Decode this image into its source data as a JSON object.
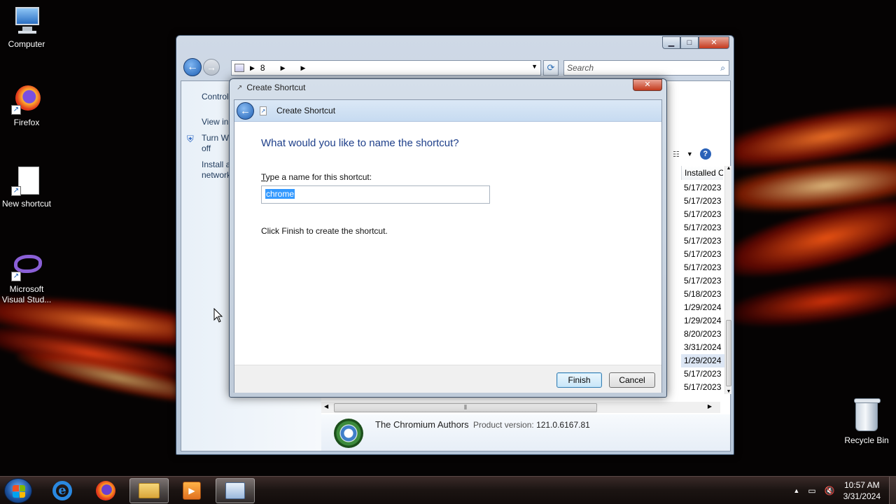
{
  "desktop": {
    "icons": [
      {
        "label": "Computer",
        "icon": "computer-icon"
      },
      {
        "label": "Firefox",
        "icon": "firefox-icon"
      },
      {
        "label": "New shortcut",
        "icon": "document-shortcut-icon"
      },
      {
        "label": "Microsoft Visual Stud...",
        "icon": "visual-studio-icon"
      }
    ],
    "recycle_bin": {
      "label": "Recycle Bin",
      "icon": "recycle-bin-icon"
    }
  },
  "control_panel": {
    "address": {
      "segment": "8"
    },
    "search_placeholder": "Search",
    "left_pane": {
      "home": "Control",
      "view": "View in",
      "turn_windows": "Turn W",
      "turn_windows_2": "off",
      "install": "Install a",
      "install_2": "network"
    },
    "column_header": "Installed On",
    "dates": [
      "5/17/2023",
      "5/17/2023",
      "5/17/2023",
      "5/17/2023",
      "5/17/2023",
      "5/17/2023",
      "5/17/2023",
      "5/17/2023",
      "5/18/2023",
      "1/29/2024",
      "1/29/2024",
      "8/20/2023",
      "3/31/2024",
      "1/29/2024",
      "5/17/2023",
      "5/17/2023"
    ],
    "selected_row_index": 13,
    "details": {
      "publisher": "The Chromium Authors",
      "version_label": "Product version:",
      "version_value": "121.0.6167.81"
    }
  },
  "dialog": {
    "window_title": "Create Shortcut",
    "wizard_title": "Create Shortcut",
    "question": "What would you like to name the shortcut?",
    "field_label_prefix": "T",
    "field_label_rest": "ype a name for this shortcut:",
    "name_value": "chrome",
    "hint": "Click Finish to create the shortcut.",
    "finish_label": "Finish",
    "cancel_label": "Cancel"
  },
  "taskbar": {
    "apps": [
      "internet-explorer-icon",
      "firefox-icon",
      "windows-explorer-icon",
      "media-player-icon",
      "control-panel-icon"
    ],
    "clock_time": "10:57 AM",
    "clock_date": "3/31/2024"
  }
}
